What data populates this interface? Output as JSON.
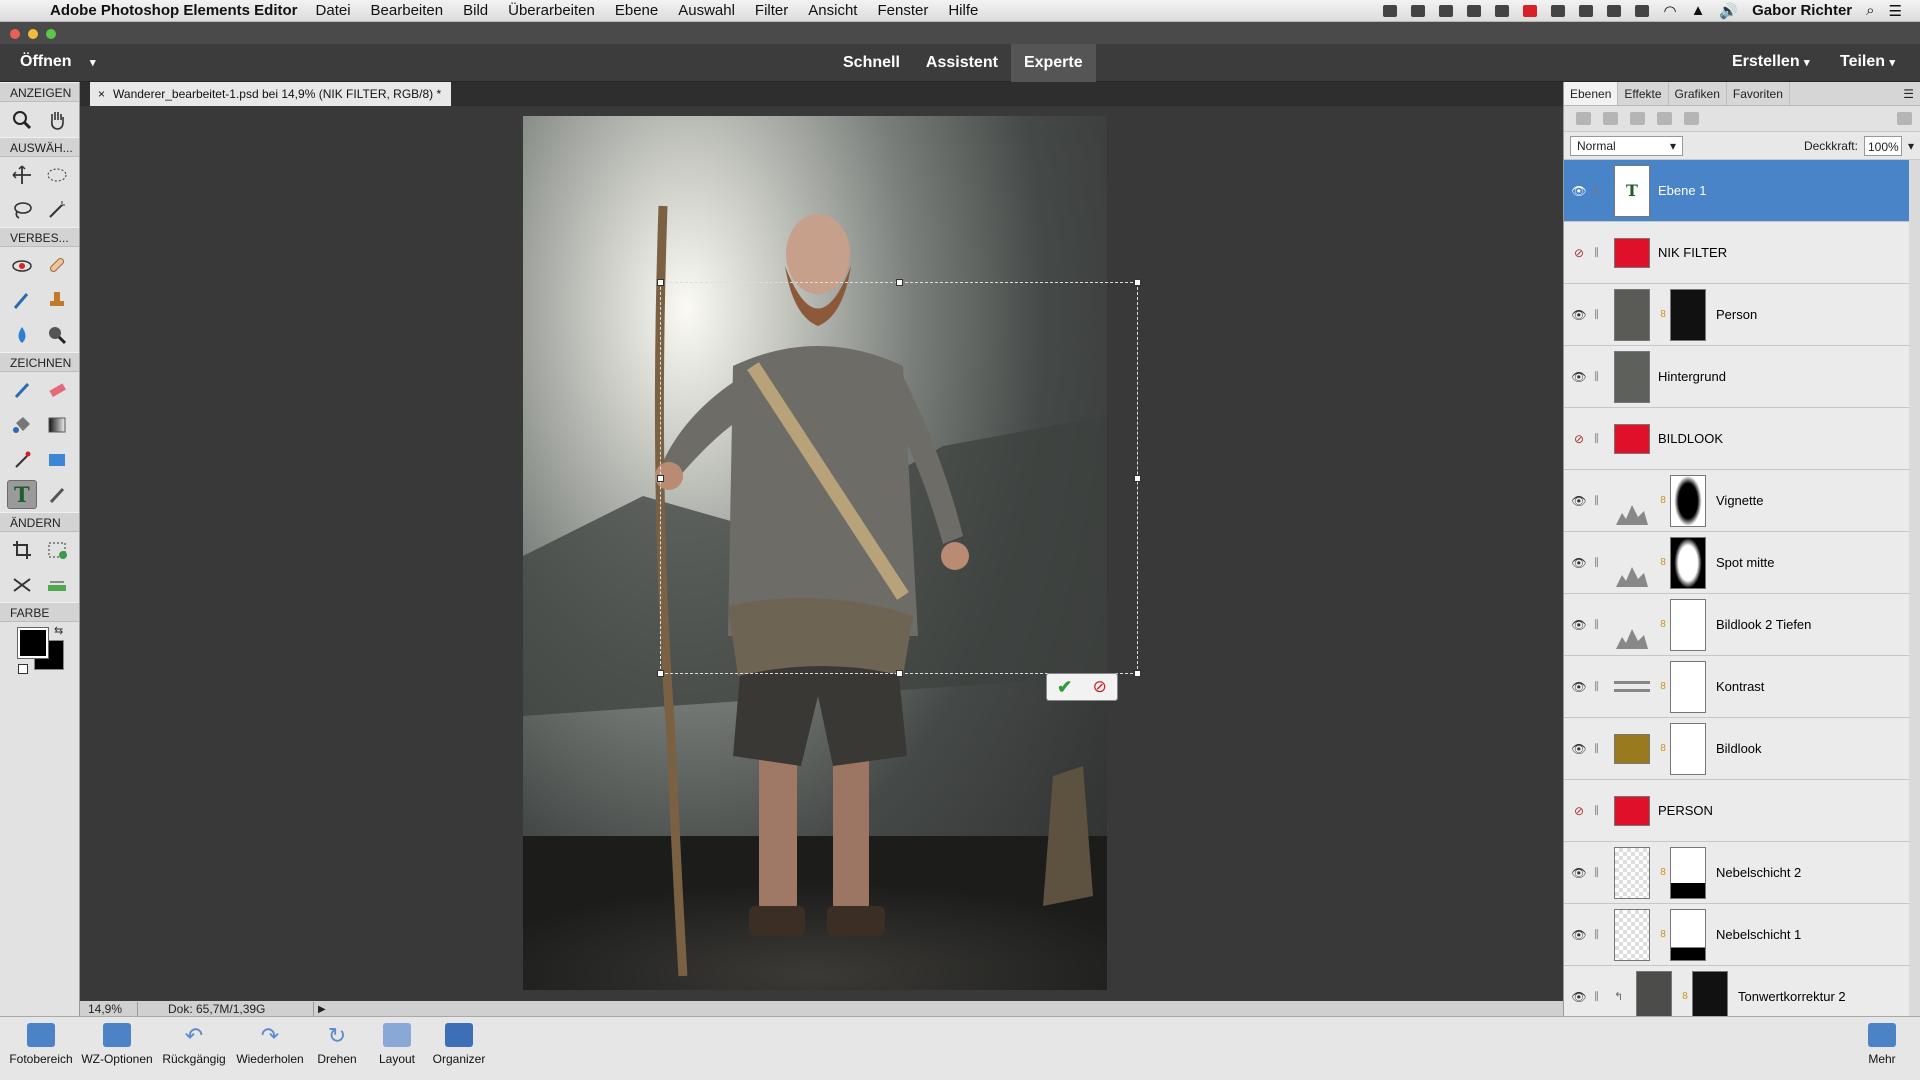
{
  "menubar": {
    "app_name": "Adobe Photoshop Elements Editor",
    "items": [
      "Datei",
      "Bearbeiten",
      "Bild",
      "Überarbeiten",
      "Ebene",
      "Auswahl",
      "Filter",
      "Ansicht",
      "Fenster",
      "Hilfe"
    ],
    "user": "Gabor Richter"
  },
  "modebar": {
    "open_label": "Öffnen",
    "modes": [
      "Schnell",
      "Assistent",
      "Experte"
    ],
    "active_mode": "Experte",
    "create_label": "Erstellen",
    "share_label": "Teilen"
  },
  "toolbox": {
    "sections": {
      "view": "ANZEIGEN",
      "select": "AUSWÄH...",
      "enhance": "VERBES...",
      "draw": "ZEICHNEN",
      "modify": "ÄNDERN",
      "color": "FARBE"
    }
  },
  "document": {
    "tab_title": "Wanderer_bearbeitet-1.psd bei 14,9% (NIK FILTER, RGB/8) *"
  },
  "statusbar": {
    "zoom": "14,9%",
    "doc_size": "Dok: 65,7M/1,39G"
  },
  "panel": {
    "tabs": [
      "Ebenen",
      "Effekte",
      "Grafiken",
      "Favoriten"
    ],
    "blend_mode": "Normal",
    "opacity_label": "Deckkraft:",
    "opacity_value": "100%",
    "layers": [
      {
        "name": "Ebene 1",
        "visible": true
      },
      {
        "name": "NIK FILTER",
        "visible": false
      },
      {
        "name": "Person",
        "visible": true
      },
      {
        "name": "Hintergrund",
        "visible": true
      },
      {
        "name": "BILDLOOK",
        "visible": false
      },
      {
        "name": "Vignette",
        "visible": true
      },
      {
        "name": "Spot mitte",
        "visible": true
      },
      {
        "name": "Bildlook 2 Tiefen",
        "visible": true
      },
      {
        "name": "Kontrast",
        "visible": true
      },
      {
        "name": "Bildlook",
        "visible": true
      },
      {
        "name": "PERSON",
        "visible": false
      },
      {
        "name": "Nebelschicht 2",
        "visible": true
      },
      {
        "name": "Nebelschicht 1",
        "visible": true
      },
      {
        "name": "Tonwertkorrektur 2",
        "visible": true
      }
    ]
  },
  "bottombar": {
    "items": [
      "Fotobereich",
      "WZ-Optionen",
      "Rückgängig",
      "Wiederholen",
      "Drehen",
      "Layout",
      "Organizer"
    ],
    "more": "Mehr"
  },
  "colors": {
    "selected_layer": "#4a84c8",
    "group_red": "#e0102a",
    "fill_brown": "#9a7a1e"
  }
}
